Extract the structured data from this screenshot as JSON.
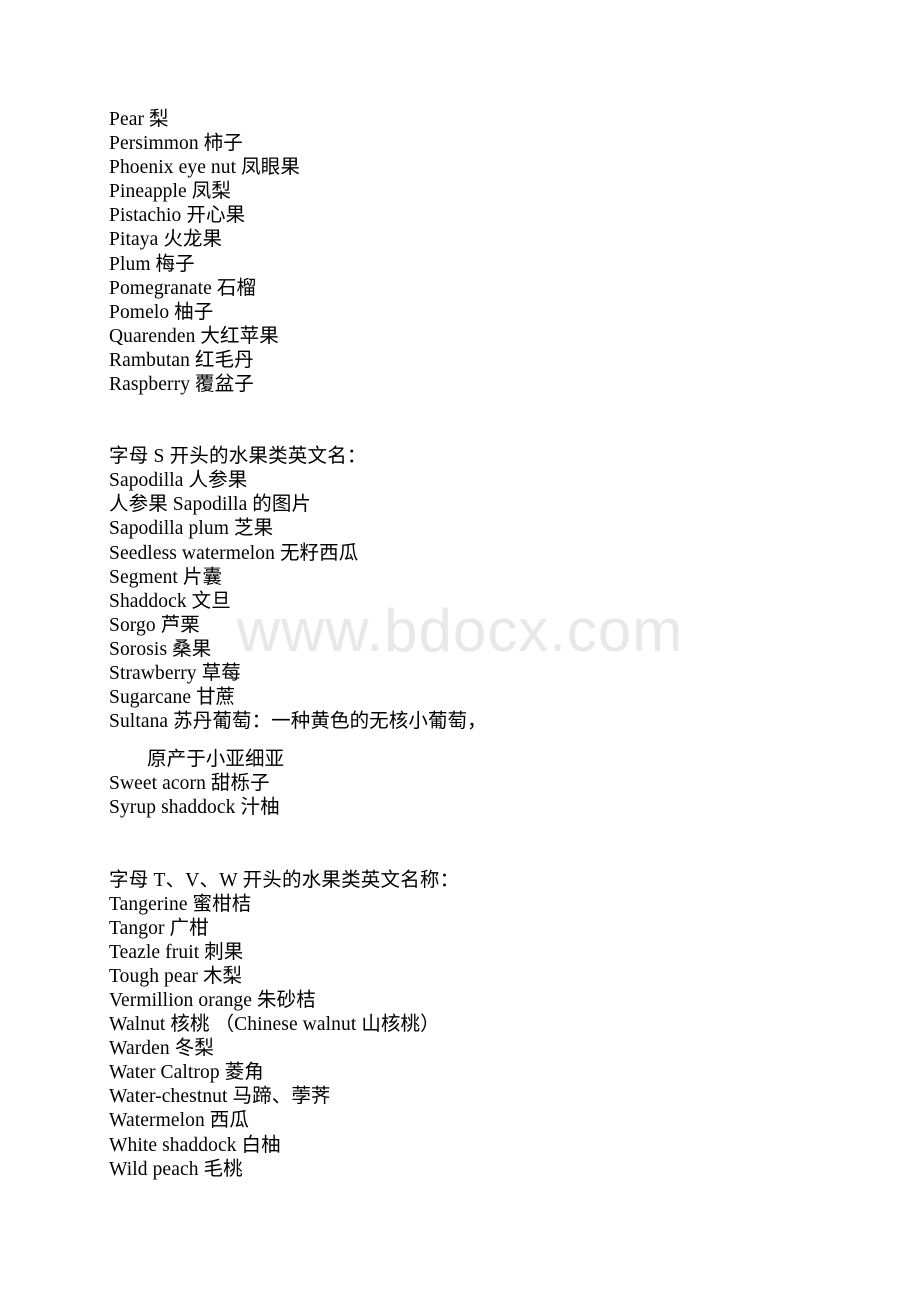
{
  "document": {
    "watermark": "www.bdocx.com",
    "blocks": [
      {
        "type": "list",
        "name": "fruit-list-p-q-r",
        "lines": [
          "Pear 梨",
          "Persimmon 柿子",
          "Phoenix eye nut 凤眼果",
          "Pineapple 凤梨",
          "Pistachio 开心果",
          "Pitaya 火龙果",
          "Plum 梅子",
          "Pomegranate 石榴",
          "Pomelo 柚子",
          "Quarenden 大红苹果",
          "Rambutan 红毛丹",
          "Raspberry 覆盆子"
        ]
      },
      {
        "type": "gap",
        "name": "section-gap-1"
      },
      {
        "type": "heading",
        "name": "section-heading-s",
        "text": "字母 S 开头的水果类英文名："
      },
      {
        "type": "list",
        "name": "fruit-list-s",
        "lines": [
          "Sapodilla 人参果",
          "人参果 Sapodilla 的图片",
          "Sapodilla plum 芝果",
          "Seedless watermelon 无籽西瓜",
          "Segment 片囊",
          "Shaddock 文旦",
          "Sorgo 芦栗",
          "Sorosis 桑果",
          "Strawberry 草莓",
          "Sugarcane 甘蔗",
          "Sultana 苏丹葡萄：一种黄色的无核小葡萄，"
        ]
      },
      {
        "type": "small-gap",
        "name": "wrap-gap"
      },
      {
        "type": "indented",
        "name": "sultana-continuation",
        "text": "原产于小亚细亚"
      },
      {
        "type": "list",
        "name": "fruit-list-s-tail",
        "lines": [
          "Sweet acorn 甜栎子",
          "Syrup shaddock 汁柚"
        ]
      },
      {
        "type": "gap",
        "name": "section-gap-2"
      },
      {
        "type": "heading",
        "name": "section-heading-t-v-w",
        "text": "字母 T、V、W 开头的水果类英文名称："
      },
      {
        "type": "list",
        "name": "fruit-list-t-v-w",
        "lines": [
          "Tangerine 蜜柑桔",
          "Tangor 广柑",
          "Teazle fruit 刺果",
          "Tough pear 木梨",
          "Vermillion orange 朱砂桔",
          "Walnut 核桃 （Chinese walnut 山核桃）",
          "Warden 冬梨",
          "Water Caltrop 菱角",
          "Water-chestnut 马蹄、荸荠",
          "Watermelon 西瓜",
          "White shaddock 白柚",
          "Wild peach 毛桃"
        ]
      }
    ]
  }
}
